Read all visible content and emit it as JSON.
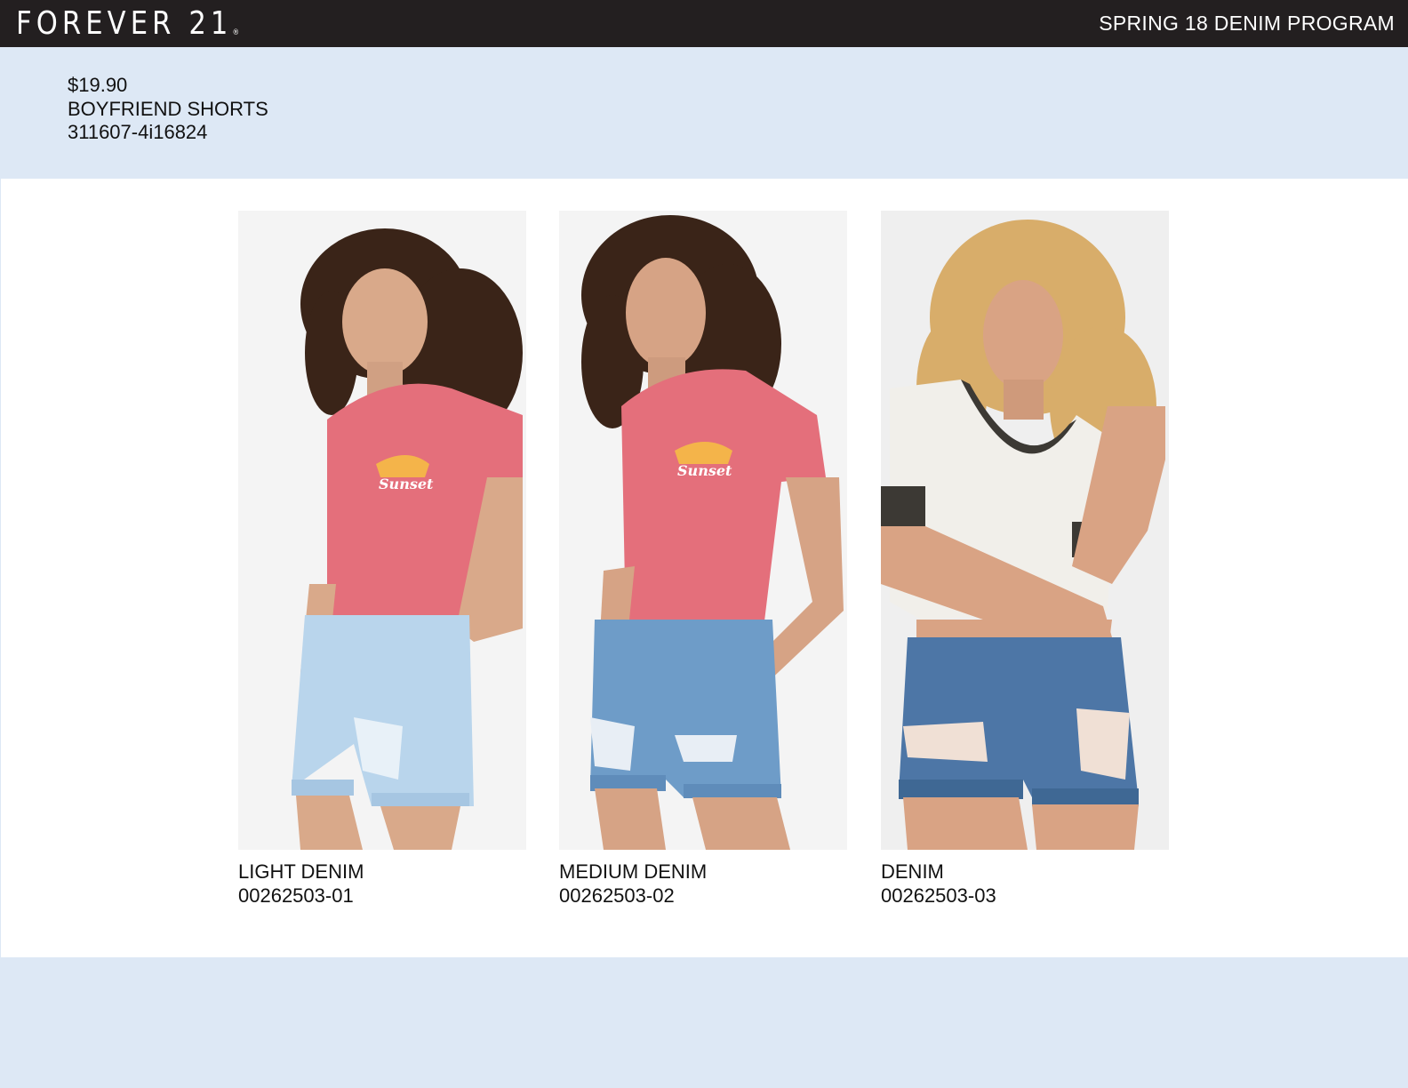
{
  "header": {
    "brand": "FOREVER 21",
    "brand_mark": "®",
    "program": "SPRING 18 DENIM PROGRAM"
  },
  "product": {
    "price": "$19.90",
    "name": "BOYFRIEND SHORTS",
    "style_number": "311607-4i16824"
  },
  "variants": [
    {
      "wash": "LIGHT DENIM",
      "sku": "00262503-01"
    },
    {
      "wash": "MEDIUM DENIM",
      "sku": "00262503-02"
    },
    {
      "wash": "DENIM",
      "sku": "00262503-03"
    }
  ],
  "colors": {
    "header_bg": "#231f20",
    "band_bg": "#dde8f5",
    "light_denim": "#b9d5ec",
    "medium_denim": "#6e9cc8",
    "dark_denim": "#4d76a6",
    "pink_tee": "#e46f7b"
  }
}
